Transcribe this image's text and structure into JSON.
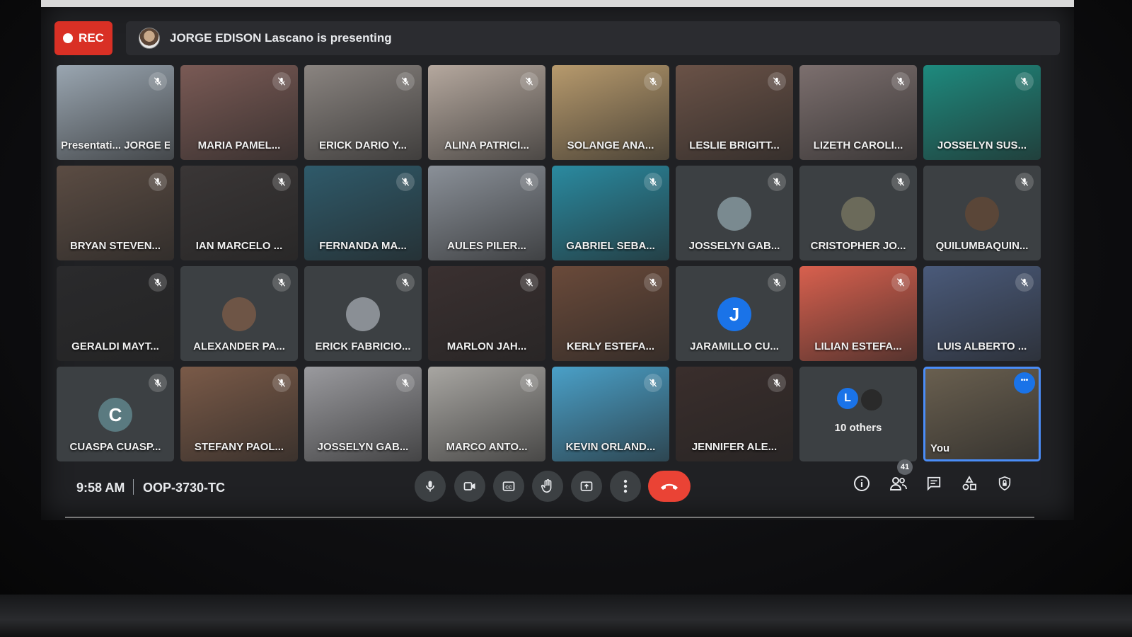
{
  "recording": {
    "label": "REC"
  },
  "presenting": {
    "text": "JORGE EDISON Lascano is presenting"
  },
  "tiles": [
    {
      "name": "Presentati... JORGE E...",
      "bg": "#9aa6b1",
      "kind": "video"
    },
    {
      "name": "MARIA PAMEL...",
      "bg": "#7a5a55",
      "kind": "video"
    },
    {
      "name": "ERICK DARIO Y...",
      "bg": "#8a8480",
      "kind": "video"
    },
    {
      "name": "ALINA PATRICI...",
      "bg": "#b5a89e",
      "kind": "video"
    },
    {
      "name": "SOLANGE ANA...",
      "bg": "#b79a6d",
      "kind": "video"
    },
    {
      "name": "LESLIE BRIGITT...",
      "bg": "#6a5247",
      "kind": "video"
    },
    {
      "name": "LIZETH CAROLI...",
      "bg": "#7c6f6e",
      "kind": "video"
    },
    {
      "name": "JOSSELYN SUS...",
      "bg": "#1e8a7e",
      "kind": "video"
    },
    {
      "name": "BRYAN STEVEN...",
      "bg": "#5b4c43",
      "kind": "video"
    },
    {
      "name": "IAN MARCELO ...",
      "bg": "#3a3636",
      "kind": "video"
    },
    {
      "name": "FERNANDA MA...",
      "bg": "#2f5a6a",
      "kind": "video"
    },
    {
      "name": "AULES PILER...",
      "bg": "#8a9098",
      "kind": "video"
    },
    {
      "name": "GABRIEL SEBA...",
      "bg": "#2a8aa0",
      "kind": "video"
    },
    {
      "name": "JOSSELYN GAB...",
      "bg": "#3c4043",
      "kind": "avatar",
      "avatar_color": "#7a8a90"
    },
    {
      "name": "CRISTOPHER JO...",
      "bg": "#3c4043",
      "kind": "avatar",
      "avatar_color": "#6b6a5a"
    },
    {
      "name": "QUILUMBAQUIN...",
      "bg": "#3c4043",
      "kind": "avatar",
      "avatar_color": "#5a4638"
    },
    {
      "name": "GERALDI MAYT...",
      "bg": "#2a2a2c",
      "kind": "video"
    },
    {
      "name": "ALEXANDER PA...",
      "bg": "#3c4043",
      "kind": "avatar",
      "avatar_color": "#6e5546"
    },
    {
      "name": "ERICK FABRICIO...",
      "bg": "#3c4043",
      "kind": "avatar",
      "avatar_color": "#8a8f95"
    },
    {
      "name": "MARLON JAH...",
      "bg": "#3a3030",
      "kind": "video"
    },
    {
      "name": "KERLY ESTEFA...",
      "bg": "#6a4a3a",
      "kind": "video"
    },
    {
      "name": "JARAMILLO CU...",
      "bg": "#3c4043",
      "kind": "letter",
      "letter": "J",
      "avatar_color": "#1a73e8"
    },
    {
      "name": "LILIAN ESTEFA...",
      "bg": "#d8604e",
      "kind": "video"
    },
    {
      "name": "LUIS ALBERTO ...",
      "bg": "#4a5a7a",
      "kind": "video"
    },
    {
      "name": "CUASPA CUASP...",
      "bg": "#3c4043",
      "kind": "letter",
      "letter": "C",
      "avatar_color": "#5a7a80"
    },
    {
      "name": "STEFANY PAOL...",
      "bg": "#7a5a48",
      "kind": "video"
    },
    {
      "name": "JOSSELYN GAB...",
      "bg": "#9a9a9e",
      "kind": "video"
    },
    {
      "name": "MARCO ANTO...",
      "bg": "#a8a6a2",
      "kind": "video"
    },
    {
      "name": "KEVIN ORLAND...",
      "bg": "#4aa0c8",
      "kind": "video"
    },
    {
      "name": "JENNIFER ALE...",
      "bg": "#3a2e2c",
      "kind": "video"
    },
    {
      "name": "10 others",
      "bg": "#3c4043",
      "kind": "others",
      "letter": "L",
      "avatar_color": "#1a73e8"
    },
    {
      "name": "You",
      "bg": "#6a6050",
      "kind": "self"
    }
  ],
  "meeting": {
    "time": "9:58 AM",
    "code": "OOP-3730-TC"
  },
  "controls": [
    "mic-icon",
    "camera-icon",
    "captions-icon",
    "raise-hand-icon",
    "present-icon",
    "more-options-icon",
    "end-call-icon"
  ],
  "right_controls": [
    "info-icon",
    "people-icon",
    "chat-icon",
    "activities-icon",
    "host-controls-icon"
  ],
  "participant_count": "41",
  "colors": {
    "rec": "#d93025",
    "end_call": "#ea4335",
    "accent": "#1a73e8"
  }
}
